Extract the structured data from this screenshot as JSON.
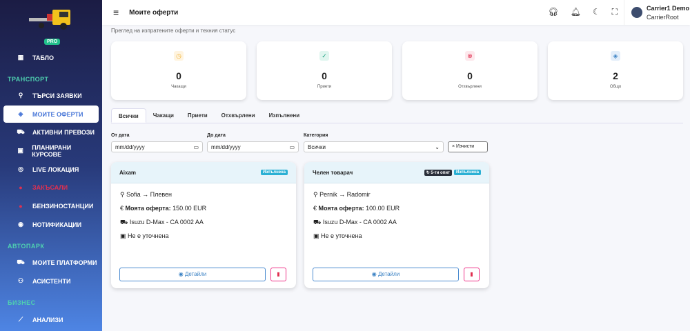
{
  "sidebar": {
    "badge": "PRO",
    "sections": [
      "ТРАНСПОРТ",
      "АВТОПАРК",
      "БИЗНЕС"
    ],
    "items": [
      {
        "label": "ТАБЛО",
        "icon": "dashboard-icon"
      },
      {
        "label": "ТЪРСИ ЗАЯВКИ",
        "icon": "search-icon"
      },
      {
        "label": "МОИТЕ ОФЕРТИ",
        "icon": "tag-icon"
      },
      {
        "label": "АКТИВНИ ПРЕВОЗИ",
        "icon": "truck-icon"
      },
      {
        "label": "ПЛАНИРАНИ КУРСОВЕ",
        "icon": "calendar-icon"
      },
      {
        "label": "LIVE ЛОКАЦИЯ",
        "icon": "location-icon"
      },
      {
        "label": "ЗАКЪСАЛИ",
        "icon": "alert-icon"
      },
      {
        "label": "БЕНЗИНОСТАНЦИИ",
        "icon": "fuel-icon"
      },
      {
        "label": "НОТИФИКАЦИИ",
        "icon": "bell-icon"
      },
      {
        "label": "МОИТЕ ПЛАТФОРМИ",
        "icon": "truck-icon"
      },
      {
        "label": "АСИСТЕНТИ",
        "icon": "users-icon"
      },
      {
        "label": "АНАЛИЗИ",
        "icon": "chart-icon"
      }
    ]
  },
  "header": {
    "title": "Моите оферти",
    "user_name": "Carrier1 Demo",
    "user_role": "CarrierRoot"
  },
  "subtitle": "Преглед на изпратените оферти и техния статус",
  "stats": [
    {
      "value": "0",
      "label": "Чакащи",
      "color": "#f0b030"
    },
    {
      "value": "0",
      "label": "Приети",
      "color": "#1aa080"
    },
    {
      "value": "0",
      "label": "Отхвърлени",
      "color": "#e03050"
    },
    {
      "value": "2",
      "label": "Общо",
      "color": "#3b82c4"
    }
  ],
  "tabs": [
    "Всички",
    "Чакащи",
    "Приети",
    "Отхвърлени",
    "Изпълнени"
  ],
  "filters": {
    "from_label": "От дата",
    "from_placeholder": "mm/dd/yyyy",
    "to_label": "До дата",
    "to_placeholder": "mm/dd/yyyy",
    "category_label": "Категория",
    "category_value": "Всички",
    "clear": "× Изчисти"
  },
  "offers": [
    {
      "name": "Aixam",
      "attempt": null,
      "status": "Изпълнена",
      "route": "Sofia → Плевен",
      "offer_label": "Моята оферта:",
      "offer_value": "150.00 EUR",
      "vehicle": "Isuzu D-Max - CA 0002 AA",
      "date": "Не е уточнена",
      "details": "Детайли"
    },
    {
      "name": "Челен товарач",
      "attempt": "5-ти опит",
      "status": "Изпълнена",
      "route": "Pernik → Radomir",
      "offer_label": "Моята оферта:",
      "offer_value": "100.00 EUR",
      "vehicle": "Isuzu D-Max - CA 0002 AA",
      "date": "Не е уточнена",
      "details": "Детайли"
    }
  ]
}
